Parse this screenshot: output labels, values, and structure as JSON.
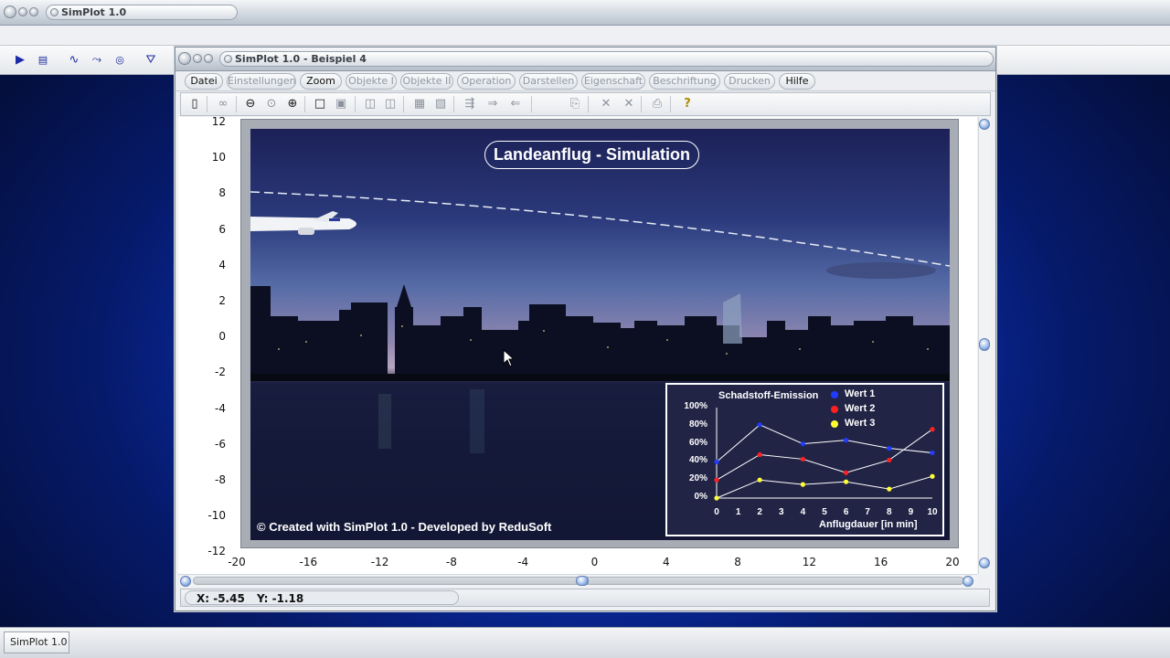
{
  "app": {
    "title": "SimPlot 1.0",
    "taskbar_label": "SimPlot 1.0"
  },
  "child_window": {
    "title": "SimPlot 1.0 - Beispiel 4",
    "menu": [
      {
        "label": "Datei",
        "enabled": true
      },
      {
        "label": "Einstellungen",
        "enabled": false
      },
      {
        "label": "Zoom",
        "enabled": true
      },
      {
        "label": "Objekte I",
        "enabled": false
      },
      {
        "label": "Objekte II",
        "enabled": false
      },
      {
        "label": "Operation",
        "enabled": false
      },
      {
        "label": "Darstellen",
        "enabled": false
      },
      {
        "label": "Eigenschaft",
        "enabled": false
      },
      {
        "label": "Beschriftung",
        "enabled": false
      },
      {
        "label": "Drucken",
        "enabled": false
      },
      {
        "label": "Hilfe",
        "enabled": true
      }
    ]
  },
  "plot": {
    "y_ticks": [
      "12",
      "10",
      "8",
      "6",
      "4",
      "2",
      "0",
      "-2",
      "-4",
      "-6",
      "-8",
      "-10",
      "-12"
    ],
    "x_ticks": [
      "-20",
      "-16",
      "-12",
      "-8",
      "-4",
      "0",
      "4",
      "8",
      "12",
      "16",
      "20"
    ],
    "image_title": "Landeanflug - Simulation",
    "copyright": "© Created with SimPlot 1.0 - Developed by ReduSoft"
  },
  "chart_data": {
    "type": "line",
    "title": "Schadstoff-Emission",
    "xlabel": "Anflugdauer [in  min]",
    "ylabel": "",
    "x": [
      0,
      1,
      2,
      3,
      4,
      5,
      6,
      7,
      8,
      9,
      10
    ],
    "x_tick_labels": [
      "0",
      "1",
      "2",
      "3",
      "4",
      "5",
      "6",
      "7",
      "8",
      "9",
      "10"
    ],
    "y_tick_labels": [
      "100%",
      "80%",
      "60%",
      "40%",
      "20%",
      "0%"
    ],
    "ylim": [
      0,
      100
    ],
    "xlim": [
      0,
      10
    ],
    "legend_position": "top-right",
    "series": [
      {
        "name": "Wert 1",
        "color": "#1f3cff",
        "x": [
          0,
          2,
          4,
          6,
          8,
          10
        ],
        "values": [
          40,
          81,
          60,
          64,
          55,
          50
        ]
      },
      {
        "name": "Wert 2",
        "color": "#ff2020",
        "x": [
          0,
          2,
          4,
          6,
          8,
          10
        ],
        "values": [
          20,
          48,
          43,
          28,
          42,
          76
        ]
      },
      {
        "name": "Wert 3",
        "color": "#ffff33",
        "x": [
          0,
          2,
          4,
          6,
          8,
          10
        ],
        "values": [
          0,
          20,
          15,
          18,
          10,
          24
        ]
      }
    ]
  },
  "status": {
    "x": "X: -5.45",
    "y": "Y: -1.18"
  }
}
